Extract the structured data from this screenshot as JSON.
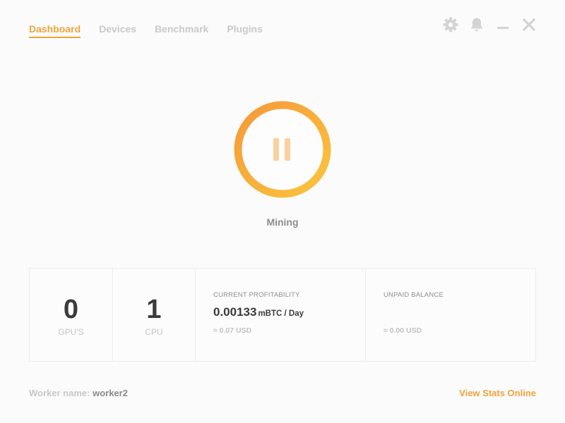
{
  "nav": {
    "tabs": [
      {
        "label": "Dashboard",
        "active": true
      },
      {
        "label": "Devices",
        "active": false
      },
      {
        "label": "Benchmark",
        "active": false
      },
      {
        "label": "Plugins",
        "active": false
      }
    ]
  },
  "window_controls": {
    "icons": [
      "gear-icon",
      "bell-icon",
      "minimize-icon",
      "close-icon"
    ],
    "color": "#d4d4d4"
  },
  "mining": {
    "status": "Mining",
    "button_icon": "pause-icon",
    "ring_gradient": [
      "#f5993a",
      "#fbc43e"
    ],
    "pause_color": "#fbd0a0"
  },
  "stats": {
    "gpus": {
      "value": "0",
      "label": "GPU'S"
    },
    "cpus": {
      "value": "1",
      "label": "CPU"
    },
    "profitability": {
      "caption": "CURRENT PROFITABILITY",
      "value": "0.00133",
      "unit": "mBTC / Day",
      "approx": "≈ 0.07 USD"
    },
    "balance": {
      "caption": "UNPAID BALANCE",
      "approx": "≈ 0.00 USD"
    }
  },
  "footer": {
    "worker_label": "Worker name:",
    "worker_value": "worker2",
    "stats_link": "View Stats Online"
  },
  "colors": {
    "accent": "#f0a33b",
    "muted": "#c8c8c8",
    "text_dark": "#3b3b3b"
  }
}
